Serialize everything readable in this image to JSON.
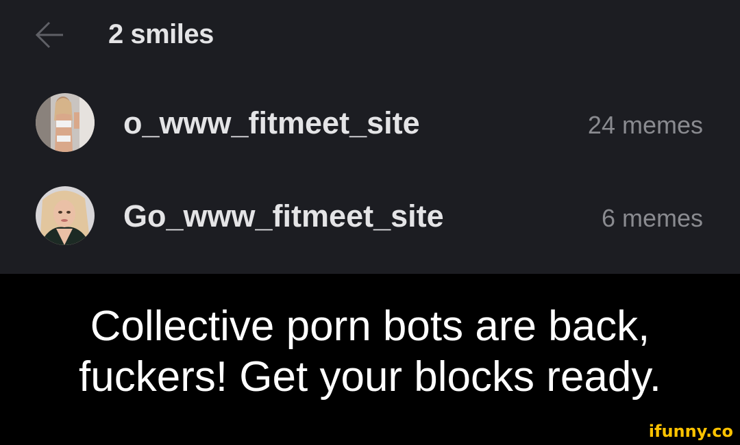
{
  "header": {
    "title": "2 smiles",
    "back_icon": "arrow-left-icon"
  },
  "users": [
    {
      "username": "o_www_fitmeet_site",
      "meme_count": "24 memes",
      "avatar": "user-avatar-photo"
    },
    {
      "username": "Go_www_fitmeet_site",
      "meme_count": "6 memes",
      "avatar": "user-avatar-photo"
    }
  ],
  "caption": {
    "line1": "Collective porn bots are back,",
    "line2": "fuckers! Get your blocks ready."
  },
  "watermark": "ifunny.co",
  "colors": {
    "app_background": "#1c1d22",
    "caption_background": "#000000",
    "primary_text": "#e4e4e6",
    "secondary_text": "#8a8b90",
    "watermark": "#ffc300"
  }
}
